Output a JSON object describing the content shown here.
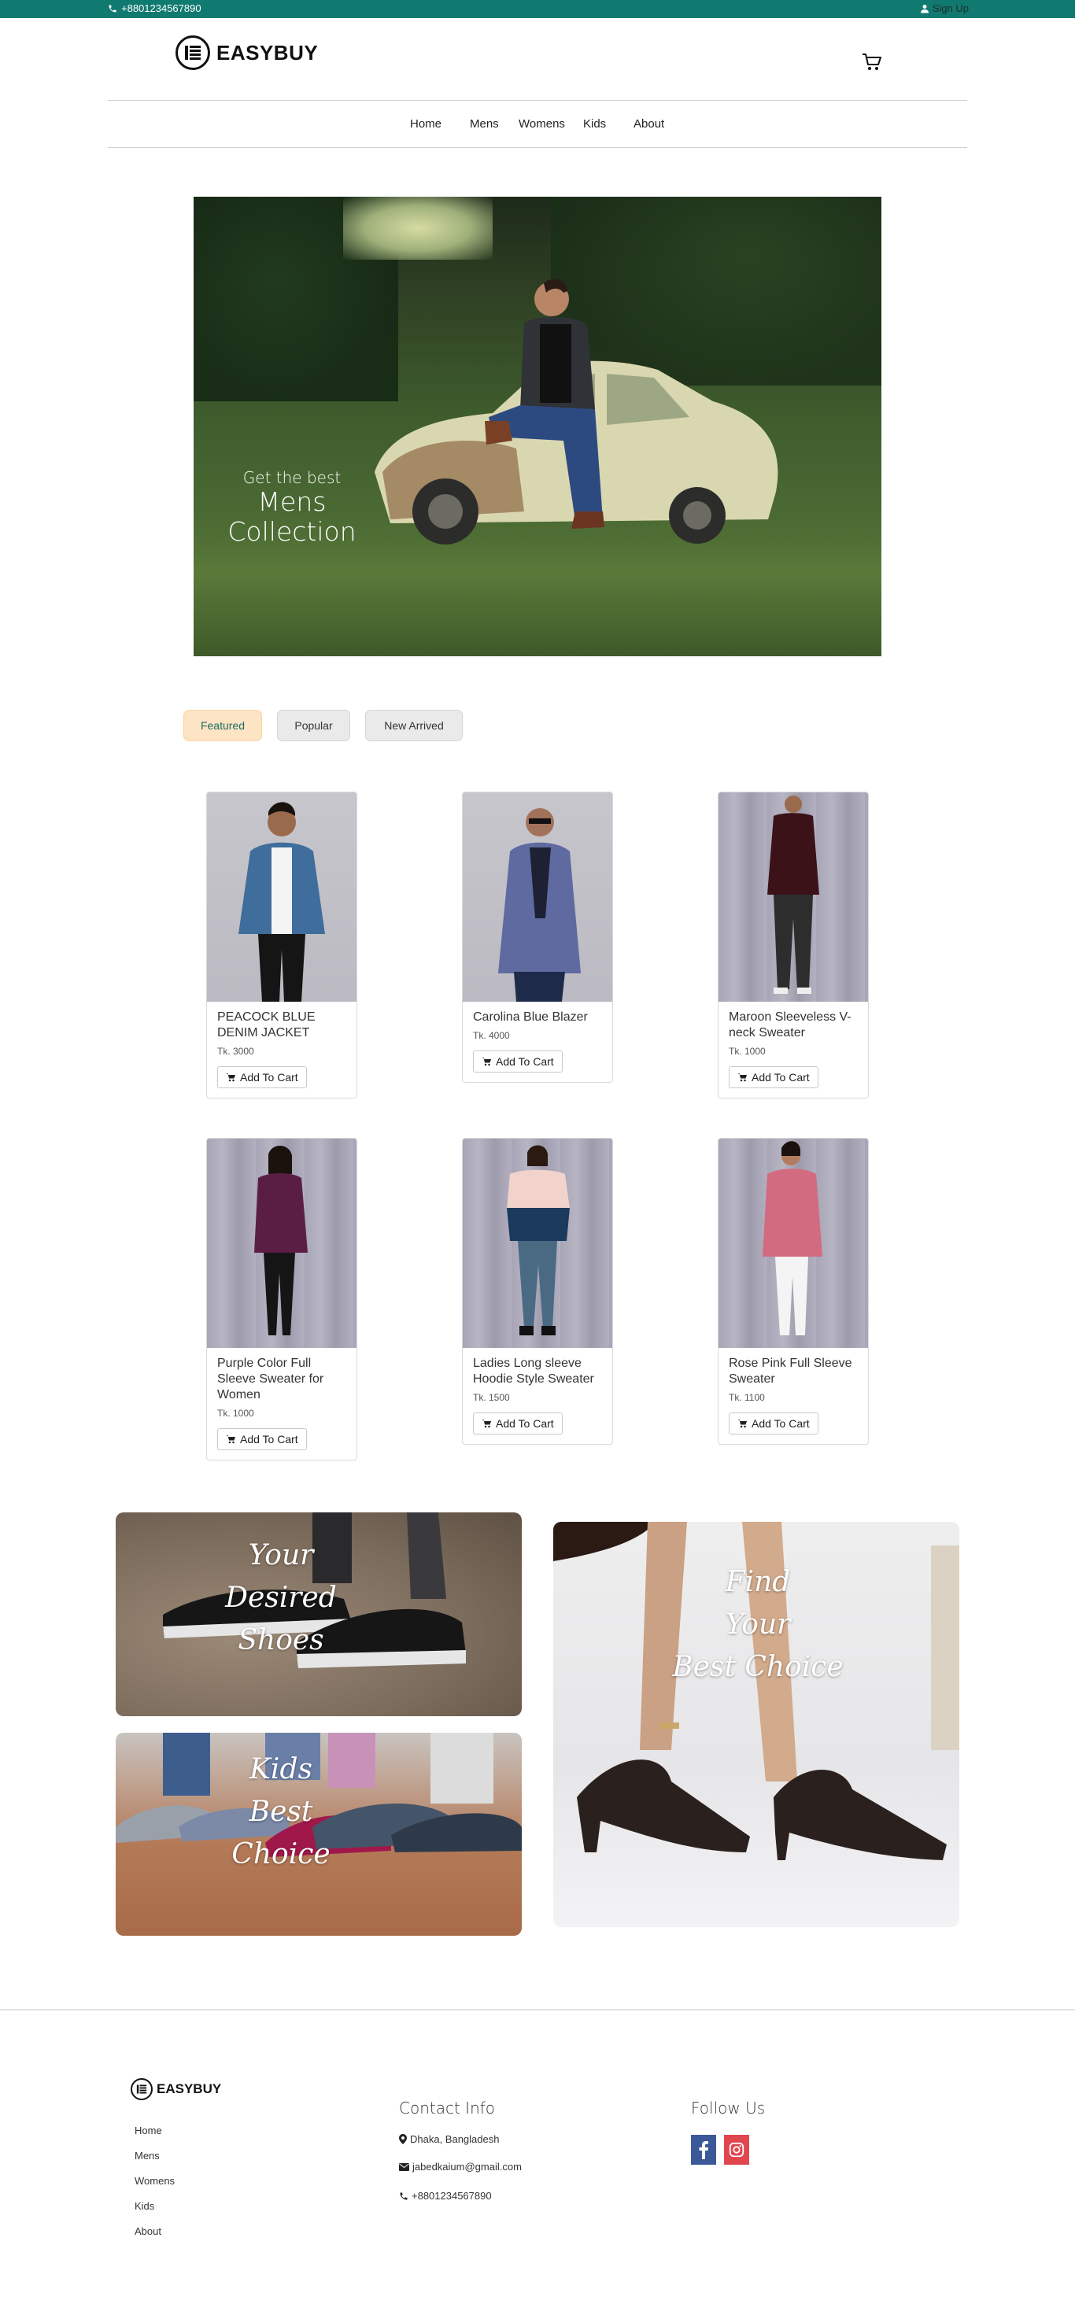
{
  "topbar": {
    "phone": "+8801234567890",
    "signup": "Sign Up",
    "bg_color": "#117a70"
  },
  "header": {
    "brand": "EASYBUY",
    "cart_icon": "cart-icon"
  },
  "nav": {
    "items": [
      "Home",
      "Mens",
      "Womens",
      "Kids",
      "About"
    ]
  },
  "hero": {
    "subtitle": "Get the best",
    "title_line1": "Mens",
    "title_line2": "Collection"
  },
  "tabs": {
    "items": [
      "Featured",
      "Popular",
      "New Arrived"
    ],
    "active": "Featured"
  },
  "products": [
    {
      "name": "PEACOCK BLUE DENIM JACKET",
      "price": "Tk. 3000",
      "button": "Add To Cart"
    },
    {
      "name": "Carolina Blue Blazer",
      "price": "Tk. 4000",
      "button": "Add To Cart"
    },
    {
      "name": "Maroon Sleeveless V-neck Sweater",
      "price": "Tk. 1000",
      "button": "Add To Cart"
    },
    {
      "name": "Purple Color Full Sleeve Sweater for Women",
      "price": "Tk. 1000",
      "button": "Add To Cart"
    },
    {
      "name": "Ladies Long sleeve Hoodie Style Sweater",
      "price": "Tk. 1500",
      "button": "Add To Cart"
    },
    {
      "name": "Rose Pink Full Sleeve Sweater",
      "price": "Tk. 1100",
      "button": "Add To Cart"
    }
  ],
  "promos": {
    "shoes": [
      "Your",
      "Desired",
      "Shoes"
    ],
    "kids": [
      "Kids",
      "Best",
      "Choice"
    ],
    "find": [
      "Find",
      "Your",
      "Best Choice"
    ]
  },
  "footer": {
    "brand": "EASYBUY",
    "links": [
      "Home",
      "Mens",
      "Womens",
      "Kids",
      "About"
    ],
    "contact_heading": "Contact Info",
    "address": "Dhaka, Bangladesh",
    "email": "jabedkaium@gmail.com",
    "phone": "+8801234567890",
    "follow_heading": "Follow Us",
    "facebook_color": "#3b5998",
    "instagram_color": "#e1464f"
  }
}
